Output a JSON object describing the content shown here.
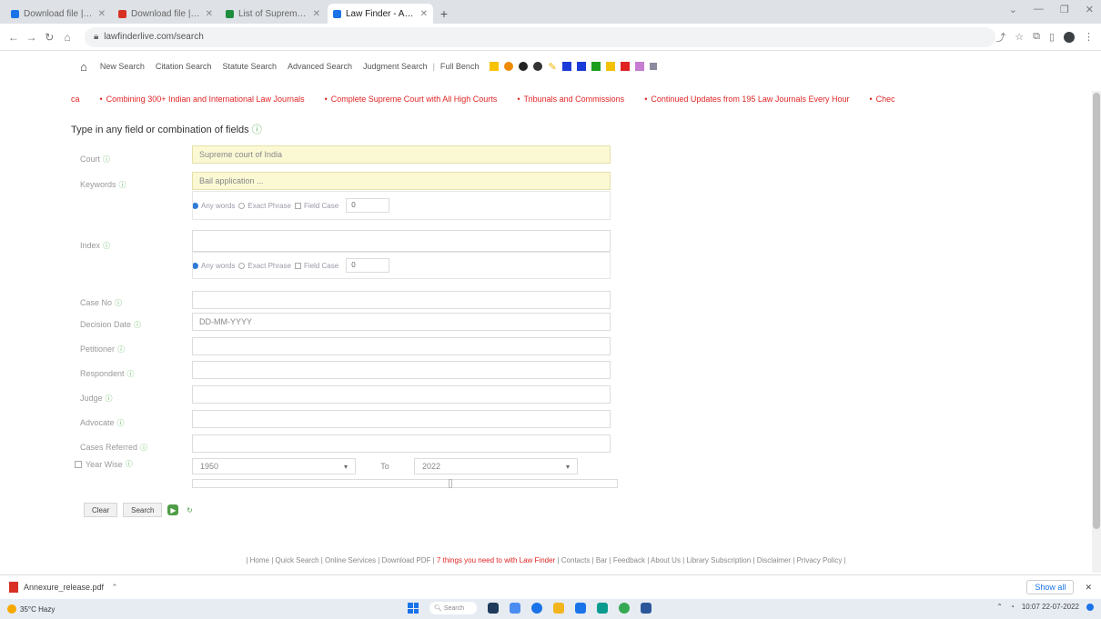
{
  "browser": {
    "tabs": [
      {
        "label": "Download file | LiveMint",
        "color": "#1a73e8",
        "active": false
      },
      {
        "label": "Download file | LiveMint",
        "color": "#d93025",
        "active": false
      },
      {
        "label": "List of Supreme Court judgment",
        "color": "#1e8e3e",
        "active": false
      },
      {
        "label": "Law Finder - Advanced Search",
        "color": "#1a73e8",
        "active": true
      }
    ],
    "new_tab": "+",
    "url": "lawfinderlive.com/search",
    "window_controls": [
      "⌄",
      "—",
      "❐",
      "✕"
    ]
  },
  "site_nav": {
    "links": [
      "New Search",
      "Citation Search",
      "Statute Search",
      "Advanced Search",
      "Judgment Search"
    ],
    "tools_label": "Full Bench",
    "swatches": [
      "#f7c200",
      "#f08a00",
      "#222222",
      "#333333",
      "#1a3bd8",
      "#1a3bd8",
      "#1e9e1e",
      "#f2c200",
      "#e02424",
      "#c77dd1",
      "#8a8aa0"
    ]
  },
  "ticker": {
    "items": [
      "ca",
      "Combining 300+ Indian and International Law Journals",
      "Complete Supreme Court with All High Courts",
      "Tribunals and Commissions",
      "Continued Updates from 195 Law Journals Every Hour",
      "Chec"
    ]
  },
  "form": {
    "heading": "Type in any field or combination of fields",
    "fields": {
      "court": {
        "label": "Court",
        "value": "Supreme court of India"
      },
      "keywords": {
        "label": "Keywords",
        "value": "Bail application ..."
      },
      "index": {
        "label": "Index",
        "value": ""
      },
      "case_no": {
        "label": "Case No",
        "value": ""
      },
      "decision_date": {
        "label": "Decision Date",
        "value": "DD-MM-YYYY"
      },
      "petitioner": {
        "label": "Petitioner",
        "value": ""
      },
      "respondent": {
        "label": "Respondent",
        "value": ""
      },
      "judge": {
        "label": "Judge",
        "value": ""
      },
      "advocate": {
        "label": "Advocate",
        "value": ""
      },
      "cases_referred": {
        "label": "Cases Referred",
        "value": ""
      }
    },
    "search_options": {
      "any_words": "Any words",
      "exact_phrase": "Exact Phrase",
      "field_case": "Field Case",
      "number": "0"
    },
    "year_checkbox": "Year Wise",
    "year_from": "1950",
    "year_to_label": "To",
    "year_to": "2022",
    "buttons": {
      "clear": "Clear",
      "search": "Search"
    }
  },
  "footer": {
    "left": "| Home | Quick Search | Online Services | Download PDF |",
    "highlight": "7 things you need to with Law Finder",
    "right": "| Contacts | Bar | Feedback | About Us | Library Subscription | Disclaimer | Privacy Policy |"
  },
  "download_bar": {
    "file": "Annexure_release.pdf",
    "show_all": "Show all"
  },
  "taskbar": {
    "weather": "35°C Hazy",
    "search_placeholder": "Search",
    "time": "10:07",
    "date": "22-07-2022"
  }
}
